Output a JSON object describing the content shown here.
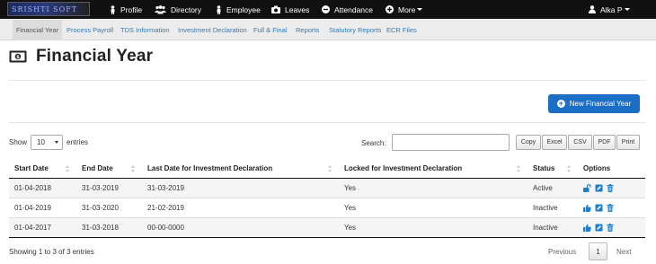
{
  "topbar": {
    "logo_text": "SRISHTI SOFT",
    "nav": [
      {
        "label": "Profile",
        "icon": "person-icon"
      },
      {
        "label": "Directory",
        "icon": "group-icon"
      },
      {
        "label": "Employee",
        "icon": "person-icon"
      },
      {
        "label": "Leaves",
        "icon": "camera-icon"
      },
      {
        "label": "Attendance",
        "icon": "minus-circle-icon"
      },
      {
        "label": "More",
        "icon": "plus-circle-icon"
      }
    ],
    "user": "Alka P"
  },
  "subnav": [
    "Financial Year",
    "Process Payroll",
    "TDS Information",
    "Investment Declaration",
    "Full & Final",
    "Reports",
    "Statutory Reports",
    "ECR Files"
  ],
  "page": {
    "title": "Financial Year",
    "new_button": "New Financial Year"
  },
  "controls": {
    "show_label": "Show",
    "entries_value": "10",
    "entries_label": "entries",
    "search_label": "Search:",
    "exports": [
      "Copy",
      "Excel",
      "CSV",
      "PDF",
      "Print"
    ]
  },
  "table": {
    "columns": [
      "Start Date",
      "End Date",
      "Last Date for Investment Declaration",
      "Locked for Investment Declaration",
      "Status",
      "Options"
    ],
    "rows": [
      {
        "start": "01-04-2018",
        "end": "31-03-2019",
        "last": "31-03-2019",
        "locked": "Yes",
        "status": "Active",
        "lock_icon": "unlock-icon"
      },
      {
        "start": "01-04-2019",
        "end": "31-03-2020",
        "last": "21-02-2019",
        "locked": "Yes",
        "status": "Inactive",
        "lock_icon": "thumbs-up-icon"
      },
      {
        "start": "01-04-2017",
        "end": "31-03-2018",
        "last": "00-00-0000",
        "locked": "Yes",
        "status": "Inactive",
        "lock_icon": "thumbs-up-icon"
      }
    ]
  },
  "footer": {
    "info": "Showing 1 to 3 of 3 entries",
    "previous": "Previous",
    "page": "1",
    "next": "Next"
  },
  "colors": {
    "accent": "#1a6fc4",
    "link": "#337ab7",
    "icon": "#1a7fd0",
    "topbar": "#111111"
  }
}
